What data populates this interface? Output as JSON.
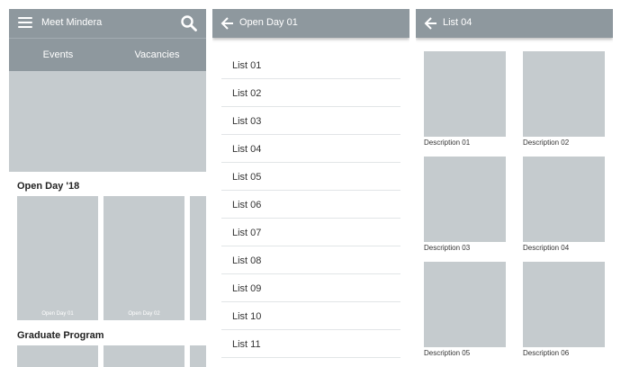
{
  "colors": {
    "appbar": "#8e989e",
    "placeholder": "#c5cbce",
    "divider": "#e2e5e7"
  },
  "screen1": {
    "menu_icon": "hamburger-menu-icon",
    "title": "Meet Mindera",
    "search_icon": "search-icon",
    "tabs": [
      {
        "label": "Events"
      },
      {
        "label": "Vacancies"
      }
    ],
    "sections": [
      {
        "title": "Open Day '18",
        "cards": [
          {
            "label": "Open Day 01"
          },
          {
            "label": "Open Day 02"
          },
          {
            "label": ""
          }
        ]
      },
      {
        "title": "Graduate Program",
        "cards": [
          {
            "label": ""
          },
          {
            "label": ""
          },
          {
            "label": ""
          }
        ]
      }
    ]
  },
  "screen2": {
    "back_icon": "arrow-back-icon",
    "title": "Open Day 01",
    "items": [
      {
        "label": "List 01"
      },
      {
        "label": "List 02"
      },
      {
        "label": "List 03"
      },
      {
        "label": "List 04"
      },
      {
        "label": "List 05"
      },
      {
        "label": "List 06"
      },
      {
        "label": "List 07"
      },
      {
        "label": "List 08"
      },
      {
        "label": "List 09"
      },
      {
        "label": "List 10"
      },
      {
        "label": "List 11"
      }
    ]
  },
  "screen3": {
    "back_icon": "arrow-back-icon",
    "title": "List 04",
    "items": [
      {
        "description": "Description 01"
      },
      {
        "description": "Description 02"
      },
      {
        "description": "Description 03"
      },
      {
        "description": "Description 04"
      },
      {
        "description": "Description 05"
      },
      {
        "description": "Description 06"
      }
    ]
  }
}
